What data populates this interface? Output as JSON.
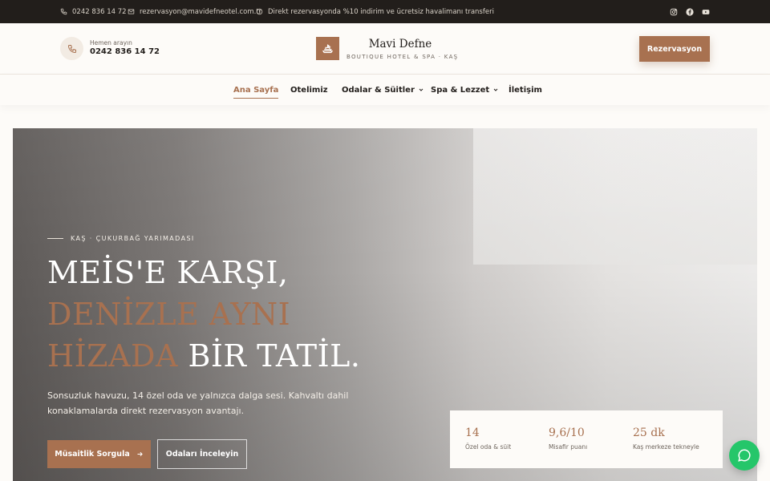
{
  "topbar": {
    "phone": "0242 836 14 72",
    "email": "rezervasyon@mavidefneotel.com.tr",
    "promo": "Direkt rezervasyonda %10 indirim ve ücretsiz havalimanı transferi",
    "icons": [
      "phone-icon",
      "mail-icon",
      "clock-icon"
    ],
    "social": [
      "instagram-icon",
      "facebook-icon",
      "youtube-icon"
    ]
  },
  "header": {
    "call_label": "Hemen arayın",
    "call_number": "0242 836 14 72",
    "brand_name": "Mavi Defne",
    "brand_sub": "BOUTIQUE HOTEL & SPA · KAŞ",
    "cta": "Rezervasyon"
  },
  "nav": {
    "items": [
      {
        "label": "Ana Sayfa",
        "active": true
      },
      {
        "label": "Otelimiz"
      },
      {
        "label": "Odalar & Süitler",
        "dropdown": true
      },
      {
        "label": "Spa & Lezzet",
        "dropdown": true
      },
      {
        "label": "İletişim"
      }
    ]
  },
  "hero": {
    "eyebrow": "KAŞ · ÇUKURBAĞ YARIMADASI",
    "headline": {
      "line1": "MEİS'E KARŞI,",
      "line2_accent": "DENİZLE AYNI",
      "line3_accent": "HİZADA",
      "line3_rest": " BİR TATİL."
    },
    "description": "Sonsuzluk havuzu, 14 özel oda ve yalnızca dalga sesi. Kahvaltı dahil konaklamalarda direkt rezervasyon avantajı.",
    "primary_button": "Müsaitlik Sorgula",
    "secondary_button": "Odaları İnceleyin"
  },
  "stats": [
    {
      "value": "14",
      "label": "Özel oda & süit"
    },
    {
      "value": "9,6/10",
      "label": "Misafir puanı"
    },
    {
      "value": "25 dk",
      "label": "Kaş merkeze tekneyle"
    }
  ],
  "colors": {
    "accent": "#a87150",
    "topbar_bg": "#221e1b",
    "chat": "#25c66a"
  }
}
